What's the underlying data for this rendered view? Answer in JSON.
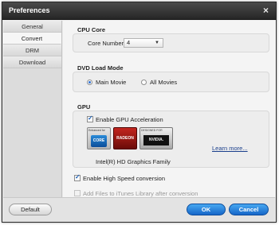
{
  "window": {
    "title": "Preferences",
    "close_glyph": "×"
  },
  "sidebar": {
    "items": [
      {
        "label": "General"
      },
      {
        "label": "Convert"
      },
      {
        "label": "DRM"
      },
      {
        "label": "Download"
      }
    ],
    "active": "Convert"
  },
  "cpu": {
    "title": "CPU Core",
    "core_label": "Core Number:",
    "core_value": "4",
    "caret": "▼"
  },
  "dvd": {
    "title": "DVD Load Mode",
    "options": [
      {
        "label": "Main Movie",
        "selected": true
      },
      {
        "label": "All Movies",
        "selected": false
      }
    ]
  },
  "gpu": {
    "title": "GPU",
    "accel_label": "Enable GPU Acceleration",
    "accel_checked": true,
    "logos": {
      "intel_caption": "Enhanced for",
      "intel_text": "CORE",
      "amd_text": "RADEON",
      "nvidia_caption": "DESIGNED FOR",
      "nvidia_text": "NVIDIA."
    },
    "learn_more": "Learn more...",
    "family": "Intel(R) HD Graphics Family"
  },
  "options": {
    "high_speed_label": "Enable High Speed conversion",
    "high_speed_checked": true,
    "itunes_label": "Add Files to iTunes Library after conversion",
    "itunes_checked": false,
    "itunes_disabled": true
  },
  "buttons": {
    "default": "Default",
    "ok": "OK",
    "cancel": "Cancel"
  },
  "colors": {
    "accent_blue": "#1667c8",
    "titlebar": "#2b2b2b",
    "panel_bg": "#ededed"
  }
}
